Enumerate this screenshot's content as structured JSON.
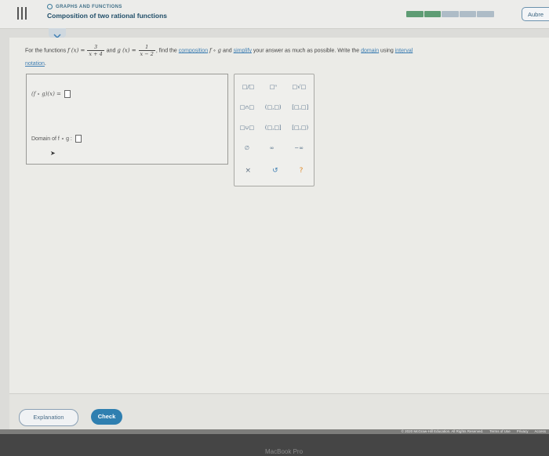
{
  "header": {
    "topic": "GRAPHS AND FUNCTIONS",
    "title": "Composition of two rational functions",
    "progress": {
      "segments": 5,
      "completed": 2
    },
    "user_button": "Aubre"
  },
  "question": {
    "intro": "For the functions",
    "f_label": "f (x) =",
    "f_num": "3",
    "f_den": "x + 4",
    "and": "and",
    "g_label": "g (x) =",
    "g_num": "1",
    "g_den": "x − 2",
    "find": ", find the",
    "link_composition": "composition",
    "comp_sym": "f ∘ g",
    "and2": "and",
    "link_simplify": "simplify",
    "rest": "your answer as much as possible. Write the",
    "link_domain": "domain",
    "using": "using",
    "link_interval": "interval",
    "link_notation": "notation",
    "period": "."
  },
  "answer": {
    "comp_expr": "(f ∘ g)(x) =",
    "domain_label": "Domain of f ∘ g :"
  },
  "palette": {
    "row1": [
      "□/□",
      "□ⁿ",
      "□√□"
    ],
    "row2": [
      "□∩□",
      "(□,□)",
      "[□,□]"
    ],
    "row3": [
      "□∪□",
      "(□,□]",
      "[□,□)"
    ],
    "row4": [
      "∅",
      "∞",
      "−∞"
    ],
    "row5": [
      "×",
      "↺",
      "?"
    ],
    "colors": {
      "close": "#5d6f80",
      "undo": "#3f7fb3",
      "help": "#e08a2a"
    }
  },
  "footer": {
    "explanation": "Explanation",
    "check": "Check",
    "copyright": "© 2020 McGraw-Hill Education. All Rights Reserved.",
    "terms": "Terms of Use",
    "privacy": "Privacy",
    "accessibility": "Access"
  },
  "device": {
    "label": "MacBook Pro"
  }
}
